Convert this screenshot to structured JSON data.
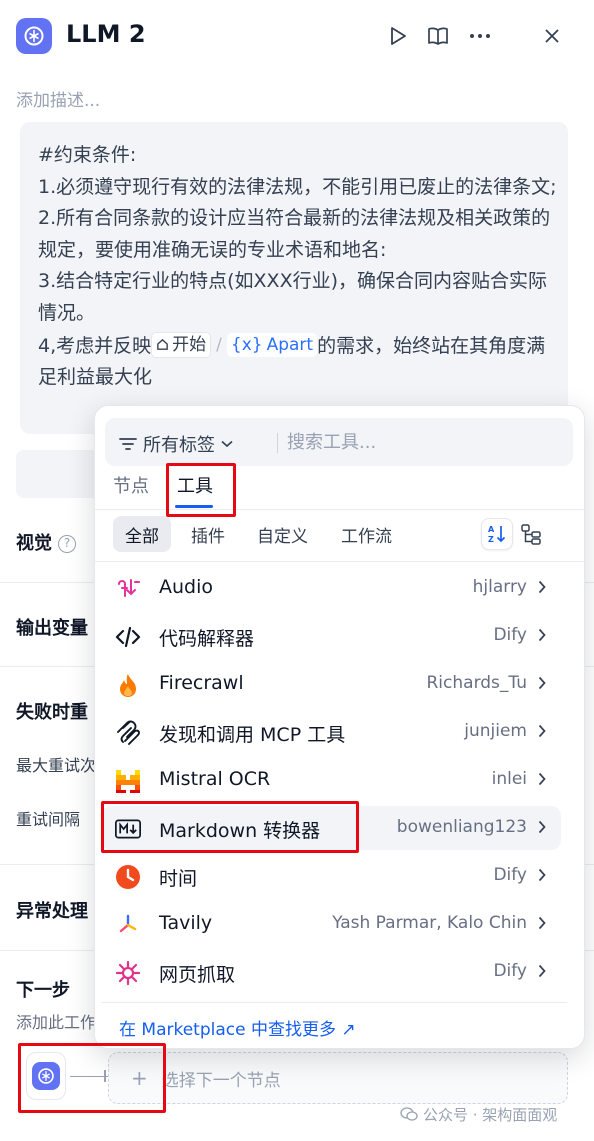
{
  "header": {
    "title": "LLM 2",
    "description_placeholder": "添加描述..."
  },
  "prompt": {
    "lines": [
      "#约束条件:",
      "1.必须遵守现行有效的法律法规，不能引用已废止的法律条文;",
      "2.所有合同条款的设计应当符合最新的法律法规及相关政策的规定，要使用准确无误的专业术语和地名:",
      "3.结合特定行业的特点(如XXX行业)，确保合同内容贴合实际情况。"
    ],
    "last_line_prefix": "4,考虑并反映",
    "chip_start": "开始",
    "chip_separator": "/",
    "chip_var_symbol": "{x}",
    "chip_var": "Apart",
    "last_line_suffix": "的需求，始终站在其角度满足利益最大化"
  },
  "sections": {
    "vision": "视觉",
    "output_vars": "输出变量",
    "retry_on_fail": "失败时重",
    "max_retries": "最大重试次",
    "retry_interval": "重试间隔",
    "error_handling": "异常处理",
    "next_step": "下一步",
    "next_step_desc": "添加此工作"
  },
  "next_node": {
    "plus": "+",
    "placeholder": "选择下一个节点"
  },
  "watermark": "公众号 · 架构面面观",
  "popup": {
    "tag_filter": "所有标签",
    "search_placeholder": "搜索工具...",
    "main_tabs": [
      "节点",
      "工具"
    ],
    "active_main_tab": "工具",
    "filters": [
      "全部",
      "插件",
      "自定义",
      "工作流"
    ],
    "active_filter": "全部",
    "tools": [
      {
        "name": "Audio",
        "author": "hjlarry",
        "icon": "audio-icon"
      },
      {
        "name": "代码解释器",
        "author": "Dify",
        "icon": "code-icon"
      },
      {
        "name": "Firecrawl",
        "author": "Richards_Tu",
        "icon": "firecrawl-icon"
      },
      {
        "name": "发现和调用 MCP 工具",
        "author": "junjiem",
        "icon": "mcp-icon"
      },
      {
        "name": "Mistral OCR",
        "author": "inlei",
        "icon": "mistral-icon"
      },
      {
        "name": "Markdown 转换器",
        "author": "bowenliang123",
        "icon": "markdown-icon"
      },
      {
        "name": "时间",
        "author": "Dify",
        "icon": "clock-icon"
      },
      {
        "name": "Tavily",
        "author": "Yash Parmar, Kalo Chin",
        "icon": "tavily-icon"
      },
      {
        "name": "网页抓取",
        "author": "Dify",
        "icon": "webscraper-icon"
      }
    ],
    "marketplace_link": "在 Marketplace 中查找更多 ↗"
  },
  "colors": {
    "accent": "#155eef",
    "app_icon": "#6172f3",
    "highlight": "#e50914"
  }
}
